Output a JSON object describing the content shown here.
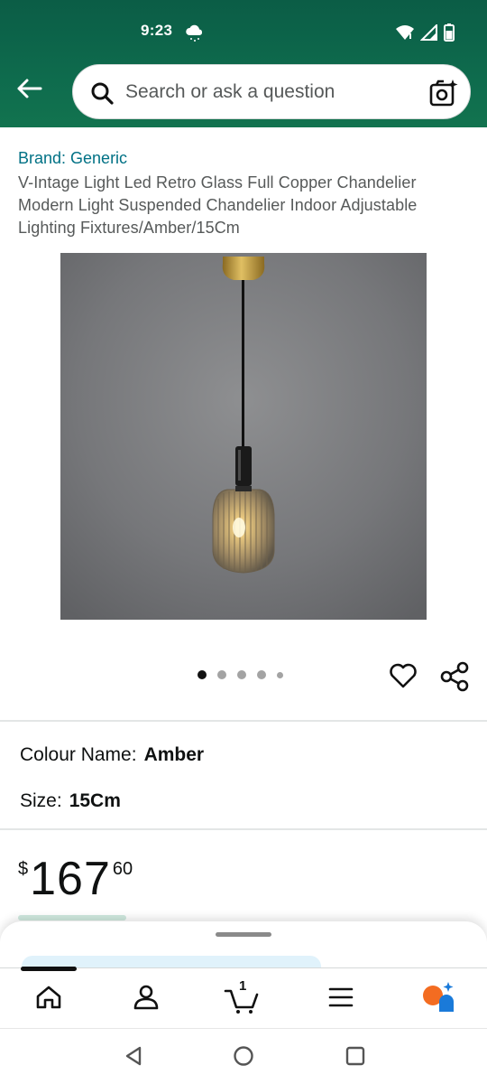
{
  "status_bar": {
    "time": "9:23",
    "weather_icon": "cloud-rain-icon",
    "wifi_icon": "wifi-icon",
    "signal_icon": "cell-signal-icon",
    "battery_icon": "battery-icon"
  },
  "header": {
    "back_icon": "arrow-left-icon",
    "search_placeholder": "Search or ask a question",
    "camera_icon": "camera-search-icon",
    "background_color": "#0e6b4d"
  },
  "product": {
    "brand": "Brand: Generic",
    "title": "V-Intage Light Led Retro Glass Full Copper Chandelier Modern Light Suspended Chandelier Indoor Adjustable Lighting Fixtures/Amber/15Cm",
    "image_subject": "amber ribbed glass pendant lamp with brass ceiling canopy",
    "image_count": 5,
    "current_image_index": 1
  },
  "variants": {
    "colour_label": "Colour Name:",
    "colour_value": "Amber",
    "size_label": "Size:",
    "size_value": "15Cm"
  },
  "price": {
    "symbol": "$",
    "whole": "167",
    "fraction": "60"
  },
  "bottom_nav": {
    "items": [
      "home-icon",
      "account-icon",
      "cart-icon",
      "menu-icon",
      "rufus-assistant-icon"
    ],
    "cart_count": "1"
  },
  "colors": {
    "link": "#007185",
    "text": "#0f1111",
    "secondary_text": "#565959"
  }
}
